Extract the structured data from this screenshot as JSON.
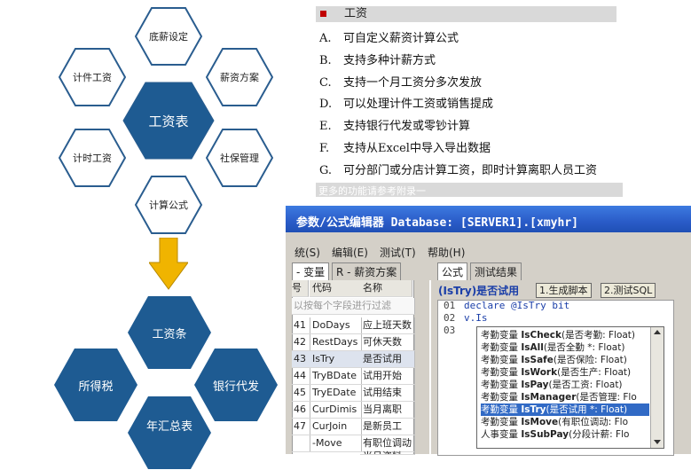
{
  "colors": {
    "hex_border": "#2a5d8f",
    "hex_fill": "#1e5b92",
    "arrow": "#f0b400",
    "bullet": "#c00000"
  },
  "diagram_top": {
    "center": "工资表",
    "nodes": [
      "底薪设定",
      "薪资方案",
      "社保管理",
      "计算公式",
      "计时工资",
      "计件工资"
    ]
  },
  "diagram_bottom": {
    "center": "工资条",
    "nodes": [
      "所得税",
      "银行代发",
      "年汇总表"
    ]
  },
  "features": {
    "title": "工资",
    "items": [
      {
        "key": "A.",
        "text": "可自定义薪资计算公式"
      },
      {
        "key": "B.",
        "text": "支持多种计薪方式"
      },
      {
        "key": "C.",
        "text": "支持一个月工资分多次发放"
      },
      {
        "key": "D.",
        "text": "可以处理计件工资或销售提成"
      },
      {
        "key": "E.",
        "text": "支持银行代发或零钞计算"
      },
      {
        "key": "F.",
        "text": "支持从Excel中导入导出数据"
      },
      {
        "key": "G.",
        "text": "可分部门或分店计算工资，即时计算离职人员工资"
      }
    ],
    "footer": "更多的功能请参考附录一"
  },
  "app": {
    "title": "参数/公式编辑器 Database: [SERVER1].[xmyhr]",
    "menu": [
      "统(S)",
      "编辑(E)",
      "测试(T)",
      "帮助(H)"
    ],
    "left_tabs": [
      "- 变量",
      "R - 薪资方案"
    ],
    "right_tabs": [
      "公式",
      "测试结果"
    ],
    "grid_headers": [
      "号",
      "代码",
      "名称"
    ],
    "filter_placeholder": "以按每个字段进行过滤",
    "rows": [
      {
        "no": "41",
        "code": "DoDays",
        "name": "应上班天数"
      },
      {
        "no": "42",
        "code": "RestDays",
        "name": "可休天数"
      },
      {
        "no": "43",
        "code": "IsTry",
        "name": "是否试用"
      },
      {
        "no": "44",
        "code": "TryBDate",
        "name": "试用开始"
      },
      {
        "no": "45",
        "code": "TryEDate",
        "name": "试用结束"
      },
      {
        "no": "46",
        "code": "CurDimis",
        "name": "当月离职"
      },
      {
        "no": "47",
        "code": "CurJoin",
        "name": "是新员工"
      },
      {
        "no": "",
        "code": "-Move",
        "name": "有职位调动"
      },
      {
        "no": "",
        "code": "",
        "name": "当月资料"
      }
    ],
    "formula_label": "(IsTry)是否试用",
    "buttons": [
      "1.生成脚本",
      "2.测试SQL"
    ],
    "code_lines": [
      {
        "no": "01",
        "text": "declare @IsTry bit"
      },
      {
        "no": "02",
        "text": "v.Is"
      },
      {
        "no": "03",
        "text": ""
      }
    ],
    "autocomplete": [
      {
        "cat": "考勤变量",
        "name": "IsCheck",
        "desc": "(是否考勤: Float)"
      },
      {
        "cat": "考勤变量",
        "name": "IsAll",
        "desc": "(是否全勤 *: Float)"
      },
      {
        "cat": "考勤变量",
        "name": "IsSafe",
        "desc": "(是否保险: Float)"
      },
      {
        "cat": "考勤变量",
        "name": "IsWork",
        "desc": "(是否生产: Float)"
      },
      {
        "cat": "考勤变量",
        "name": "IsPay",
        "desc": "(是否工资: Float)"
      },
      {
        "cat": "考勤变量",
        "name": "IsManager",
        "desc": "(是否管理: Flo"
      },
      {
        "cat": "考勤变量",
        "name": "IsTry",
        "desc": "(是否试用 *: Float)"
      },
      {
        "cat": "考勤变量",
        "name": "IsMove",
        "desc": "(有职位调动: Flo"
      },
      {
        "cat": "人事变量",
        "name": "IsSubPay",
        "desc": "(分段计薪: Flo"
      }
    ]
  }
}
